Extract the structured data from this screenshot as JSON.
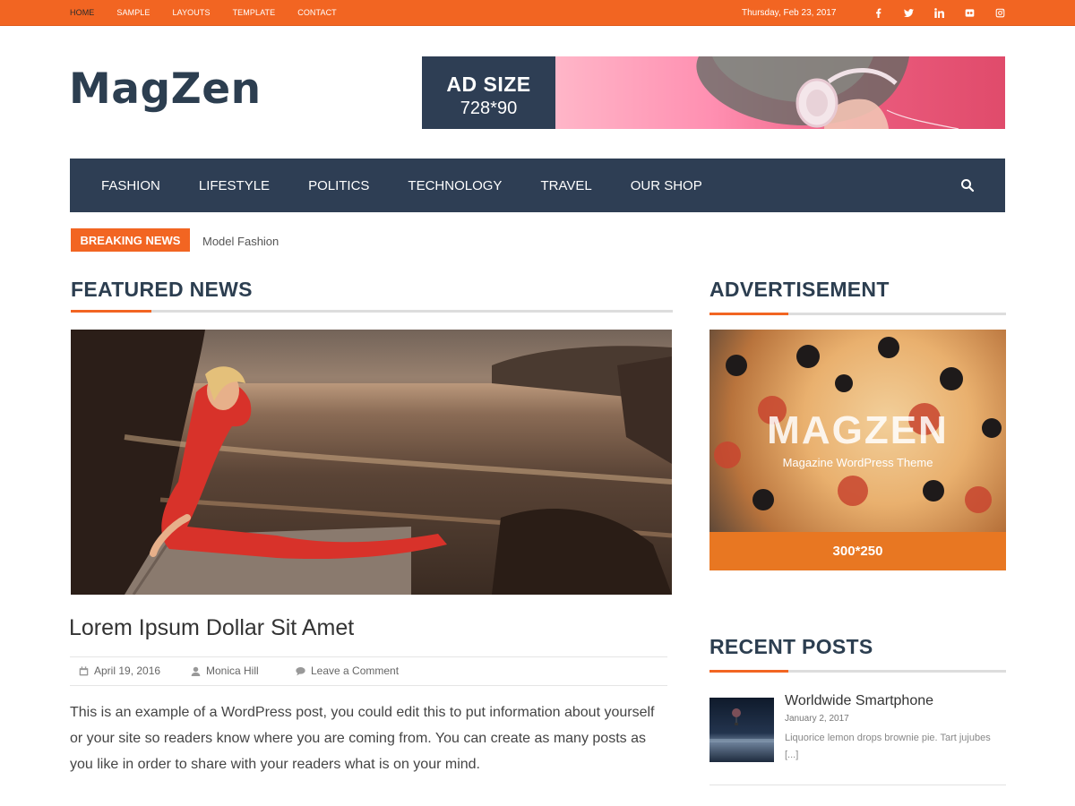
{
  "topbar": {
    "nav": [
      "HOME",
      "SAMPLE",
      "LAYOUTS",
      "TEMPLATE",
      "CONTACT"
    ],
    "date": "Thursday, Feb 23, 2017",
    "social_icons": [
      "facebook-icon",
      "twitter-icon",
      "linkedin-icon",
      "flickr-icon",
      "instagram-icon"
    ],
    "accent": "#f26522"
  },
  "header": {
    "logo": "MagZen",
    "ad_title": "AD SIZE",
    "ad_size": "728*90"
  },
  "main_nav": {
    "items": [
      "FASHION",
      "LIFESTYLE",
      "POLITICS",
      "TECHNOLOGY",
      "TRAVEL",
      "OUR SHOP"
    ],
    "background": "#2e3e54"
  },
  "breaking": {
    "label": "BREAKING NEWS",
    "text": "Model Fashion"
  },
  "featured": {
    "heading": "FEATURED NEWS",
    "post_title": "Lorem Ipsum Dollar Sit Amet",
    "date": "April 19, 2016",
    "author": "Monica Hill",
    "comments": "Leave a Comment",
    "excerpt": "This is an example of a WordPress post, you could edit this to put information about yourself or your site so readers know where you are coming from. You can create as many posts as you like in order to share with your readers what is on your mind."
  },
  "sidebar": {
    "ad_heading": "ADVERTISEMENT",
    "ad_brand": "MAGZEN",
    "ad_tagline": "Magazine WordPress Theme",
    "ad_size": "300*250",
    "recent_heading": "RECENT POSTS",
    "recent": [
      {
        "title": "Worldwide Smartphone",
        "date": "January 2, 2017",
        "excerpt": "Liquorice lemon drops brownie pie. Tart jujubes [...]"
      }
    ]
  }
}
